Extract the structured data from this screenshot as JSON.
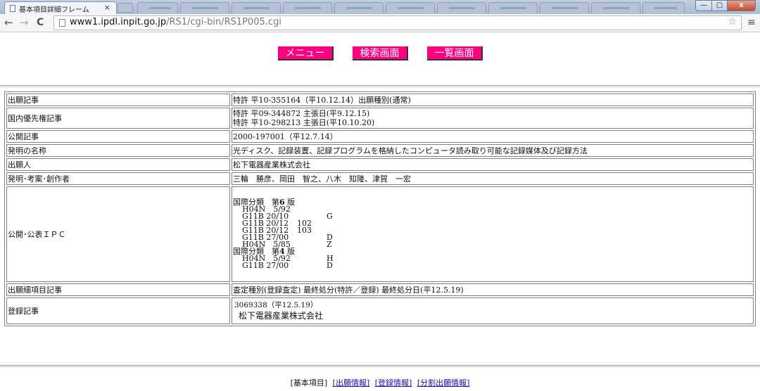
{
  "browser": {
    "tab_title": "基本項目詳細フレーム",
    "tab_close": "×",
    "url_host": "www1.ipdl.inpit.go.jp",
    "url_path": "/RS1/cgi-bin/RS1P005.cgi",
    "back": "←",
    "forward": "→",
    "reload": "C",
    "star": "☆",
    "menu": "≡",
    "win_min": "—",
    "win_max": "▢",
    "win_close": "x"
  },
  "buttons": [
    {
      "label": "メニュー"
    },
    {
      "label": "検索画面"
    },
    {
      "label": "一覧画面"
    }
  ],
  "rows": [
    {
      "label": "出願記事",
      "value": "特許 平10-355164（平10.12.14）出願種別(通常)"
    },
    {
      "label": "国内優先権記事",
      "value": "特許 平09-344872 主張日(平9.12.15)",
      "value2": "特許 平10-298213 主張日(平10.10.20)"
    },
    {
      "label": "公開記事",
      "value": "2000-197001（平12.7.14）"
    },
    {
      "label": "発明の名称",
      "value": "光ディスク、記録装置、記録プログラムを格納したコンピュータ読み取り可能な記録媒体及び記録方法"
    },
    {
      "label": "出願人",
      "value": "松下電器産業株式会社"
    },
    {
      "label": "発明･考案･創作者",
      "value": "三輪　勝彦、岡田　智之、八木　知隆、津賀　一宏"
    },
    {
      "label": "公開･公表ＩＰＣ"
    },
    {
      "label": "出願細項目記事",
      "value": "査定種別(登録査定) 最終処分(特許／登録) 最終処分日(平12.5.19)"
    },
    {
      "label": "登録記事",
      "value": "3069338（平12.5.19）",
      "value2": "松下電器産業株式会社"
    }
  ],
  "ipc": {
    "heading6_prefix": "国際分類　第",
    "heading6_num": "6",
    "heading6_suffix": "版",
    "list6": [
      {
        "code": "H04N　5/92",
        "a": "",
        "b": ""
      },
      {
        "code": "G11B 20/10",
        "a": "",
        "b": "G"
      },
      {
        "code": "G11B 20/12",
        "a": "102",
        "b": ""
      },
      {
        "code": "G11B 20/12",
        "a": "103",
        "b": ""
      },
      {
        "code": "G11B 27/00",
        "a": "",
        "b": "D"
      },
      {
        "code": "H04N　5/85",
        "a": "",
        "b": "Z"
      }
    ],
    "heading4_prefix": "国際分類　第",
    "heading4_num": "4",
    "heading4_suffix": "版",
    "list4": [
      {
        "code": "H04N　5/92",
        "a": "",
        "b": "H"
      },
      {
        "code": "G11B 27/00",
        "a": "",
        "b": "D"
      }
    ]
  },
  "footer": {
    "current": "[基本項目]",
    "link1": "[出願情報]",
    "link2": "[登録情報]",
    "link3": "[分割出願情報]"
  }
}
